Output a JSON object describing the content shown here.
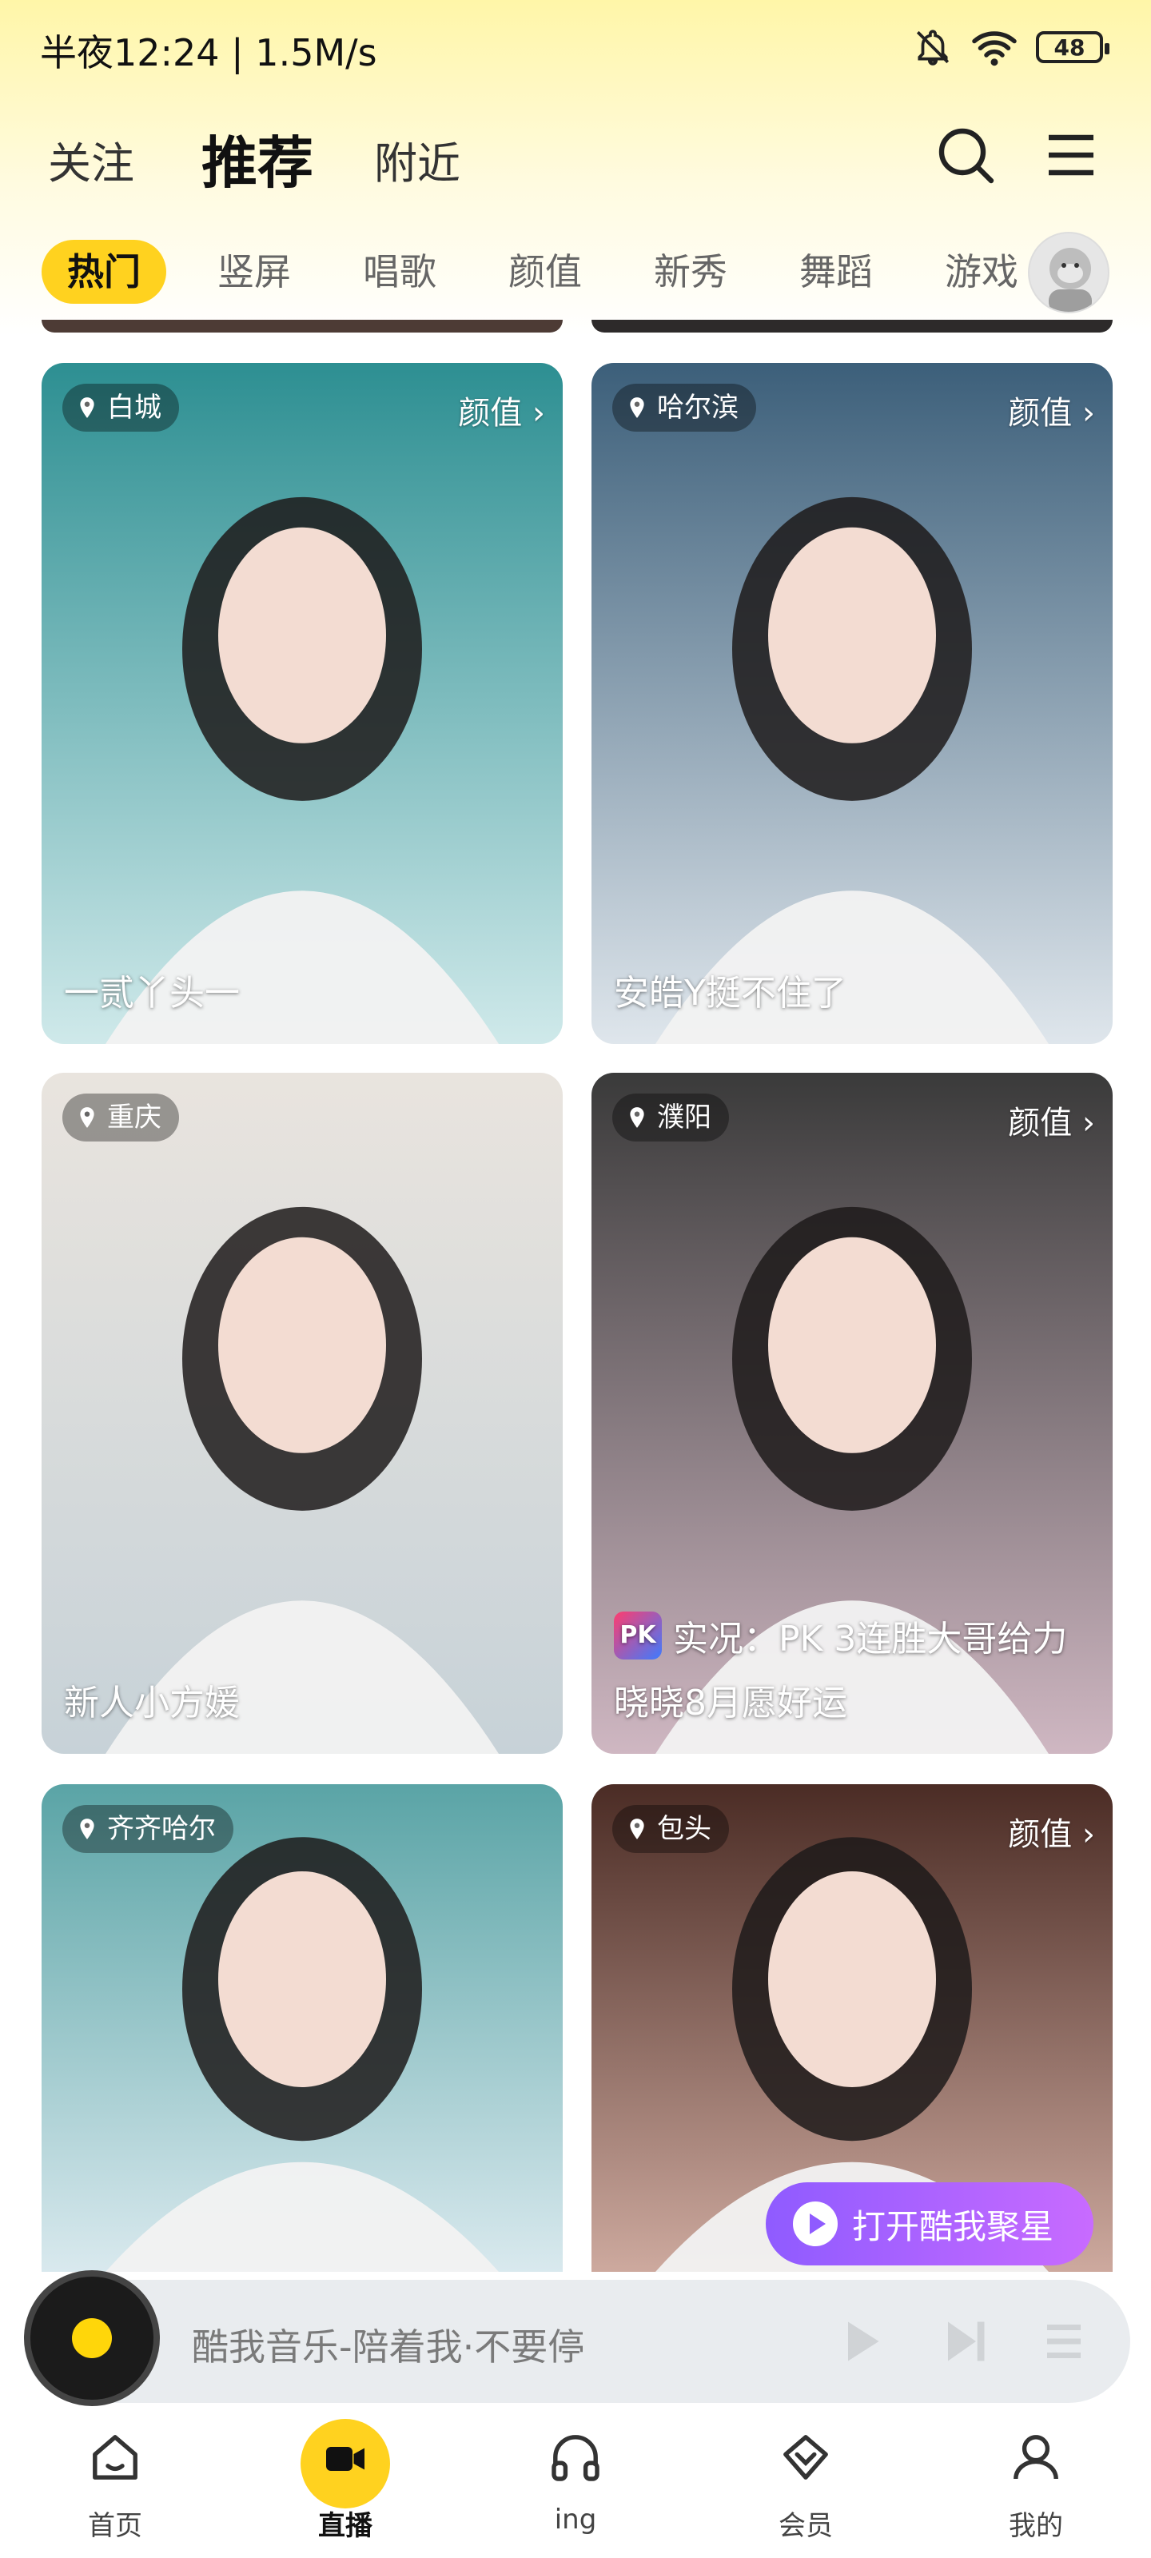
{
  "status_bar": {
    "time": "半夜12:24 | 1.5M/s",
    "battery": "48"
  },
  "header": {
    "tabs": [
      {
        "label": "关注"
      },
      {
        "label": "推荐"
      },
      {
        "label": "附近"
      }
    ],
    "icons": [
      "search-icon",
      "menu-icon"
    ]
  },
  "categories": [
    "热门",
    "竖屏",
    "唱歌",
    "颜值",
    "新秀",
    "舞蹈",
    "游戏"
  ],
  "cards": [
    {
      "location": "白城",
      "tag": "颜值 ›",
      "title": "一贰丫头一",
      "colors": [
        "#2d8f92",
        "#cfe9ea"
      ]
    },
    {
      "location": "哈尔滨",
      "tag": "颜值 ›",
      "title": "安皓Y挺不住了",
      "colors": [
        "#3c5f7a",
        "#dfe6ec"
      ]
    },
    {
      "location": "重庆",
      "tag": "",
      "title": "新人小方媛",
      "colors": [
        "#e9e4de",
        "#c7d2d8"
      ]
    },
    {
      "location": "濮阳",
      "tag": "颜值 ›",
      "title": "晓晓8月愿好运",
      "colors": [
        "#3a3a3a",
        "#cfb7c2"
      ],
      "pk": {
        "badge": "PK",
        "text": "实况：PK 3连胜大哥给力"
      }
    },
    {
      "location": "齐齐哈尔",
      "tag": "",
      "title": "",
      "colors": [
        "#5aa4a6",
        "#d9e9ee"
      ]
    },
    {
      "location": "包头",
      "tag": "颜值 ›",
      "title": "",
      "colors": [
        "#4b2c25",
        "#cda99e"
      ]
    }
  ],
  "open_app_button": "打开酷我聚星",
  "player": {
    "title": "酷我音乐-陪着我·不要停"
  },
  "bottom_nav": [
    {
      "label": "首页",
      "icon": "home-icon"
    },
    {
      "label": "直播",
      "icon": "video-icon"
    },
    {
      "label": "ing",
      "icon": "headphones-icon"
    },
    {
      "label": "会员",
      "icon": "vip-icon"
    },
    {
      "label": "我的",
      "icon": "profile-icon"
    }
  ]
}
